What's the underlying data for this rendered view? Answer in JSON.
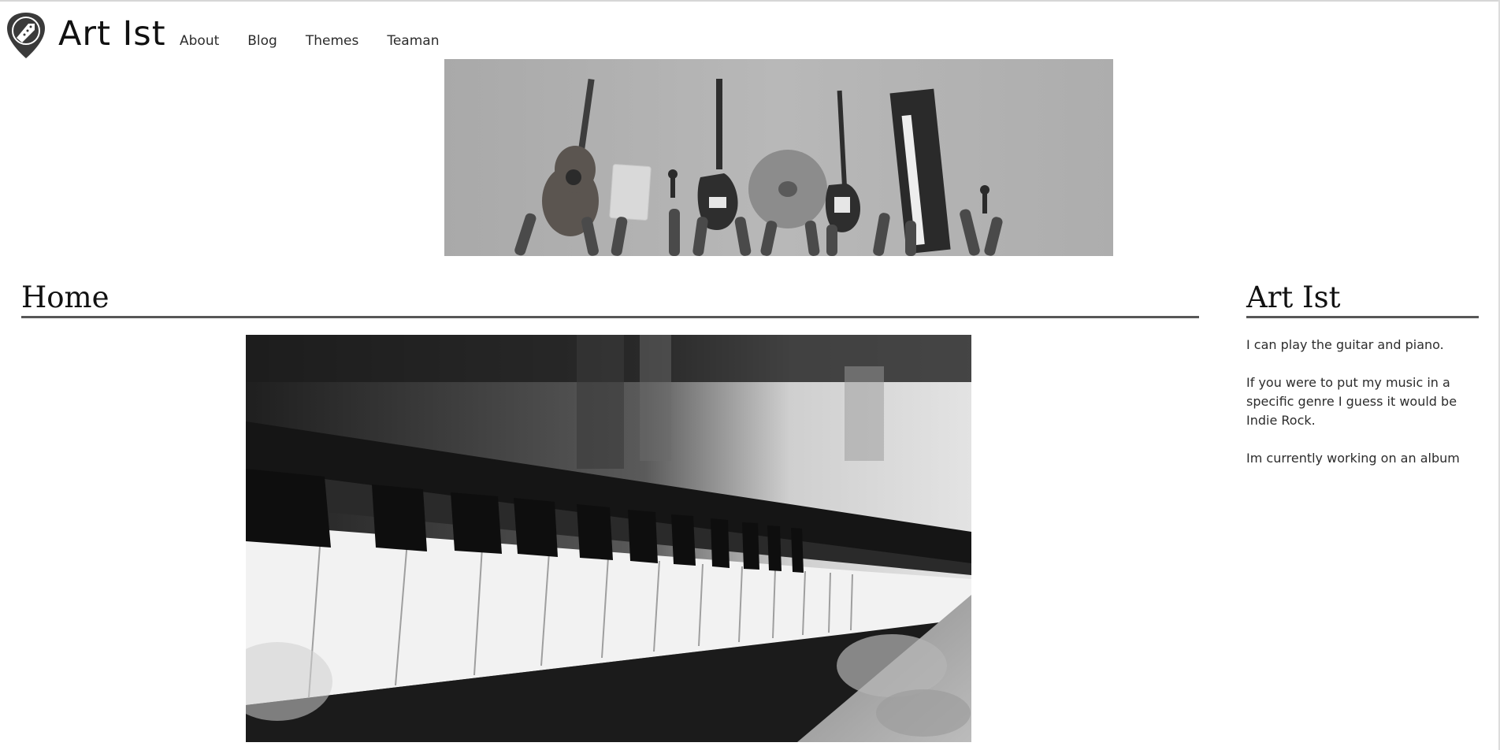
{
  "site": {
    "title": "Art Ist",
    "logo_icon": "guitar-pick-logo-icon"
  },
  "nav": {
    "items": [
      {
        "label": "About"
      },
      {
        "label": "Blog"
      },
      {
        "label": "Themes"
      },
      {
        "label": "Teaman"
      }
    ]
  },
  "banner": {
    "subject": "banner-image-raised-instruments"
  },
  "main": {
    "heading": "Home",
    "image": "piano-keys-image"
  },
  "sidebar": {
    "heading": "Art Ist",
    "paragraphs": [
      "I can play the guitar and piano.",
      "If you were to put my music in a specific genre I guess it would be Indie Rock.",
      "Im currently working on an album"
    ]
  },
  "colors": {
    "rule": "#575757",
    "text": "#2c2c2c",
    "background": "#ffffff"
  }
}
